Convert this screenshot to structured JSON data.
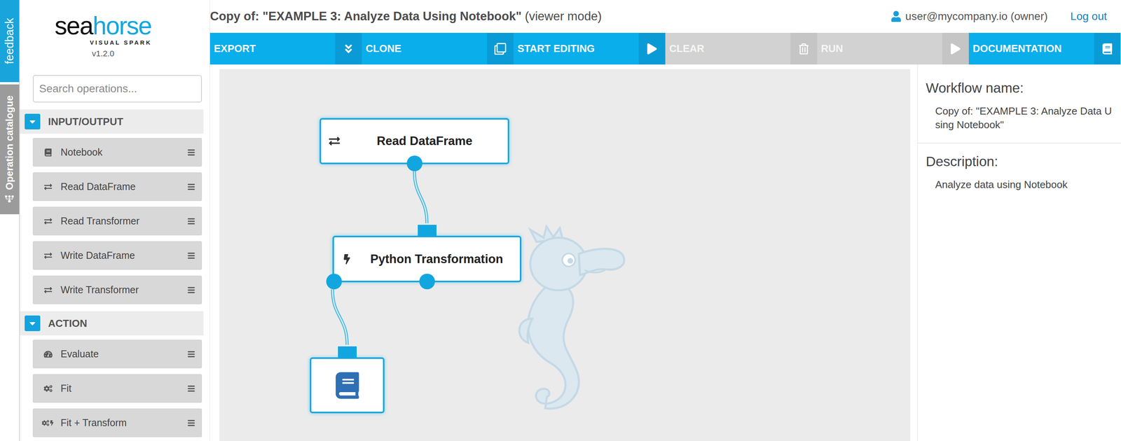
{
  "window": {
    "title": "Copy of: \"EXAMPLE 3: Analyze Data Using Notebook\"",
    "mode": "(viewer mode)"
  },
  "user": {
    "name": "user@mycompany.io (owner)",
    "logout": "Log out"
  },
  "side_tabs": [
    {
      "label": "feedback",
      "kind": "feedback"
    },
    {
      "label": "Operation catalogue",
      "kind": "catalogue"
    }
  ],
  "logo": {
    "brand_dark": "sea",
    "brand_light": "horse",
    "tagline": "VISUAL SPARK",
    "version": "v1.2.0"
  },
  "search": {
    "placeholder": "Search operations..."
  },
  "catalogue": [
    {
      "title": "INPUT/OUTPUT",
      "expanded": true,
      "items": [
        {
          "label": "Notebook",
          "kind": "notebook"
        },
        {
          "label": "Read DataFrame",
          "kind": "io"
        },
        {
          "label": "Read Transformer",
          "kind": "io"
        },
        {
          "label": "Write DataFrame",
          "kind": "io"
        },
        {
          "label": "Write Transformer",
          "kind": "io"
        }
      ]
    },
    {
      "title": "ACTION",
      "expanded": true,
      "items": [
        {
          "label": "Evaluate",
          "kind": "evaluate"
        },
        {
          "label": "Fit",
          "kind": "fit"
        },
        {
          "label": "Fit + Transform",
          "kind": "fit-transform"
        }
      ]
    }
  ],
  "toolbar": [
    {
      "label": "EXPORT",
      "kind": "export",
      "disabled": false
    },
    {
      "label": "CLONE",
      "kind": "clone",
      "disabled": false
    },
    {
      "label": "START EDITING",
      "kind": "play",
      "disabled": false
    },
    {
      "label": "CLEAR",
      "kind": "trash",
      "disabled": true
    },
    {
      "label": "RUN",
      "kind": "play",
      "disabled": true
    },
    {
      "label": "DOCUMENTATION",
      "kind": "book",
      "disabled": false
    }
  ],
  "nodes": [
    {
      "label": "Read DataFrame",
      "kind": "io"
    },
    {
      "label": "Python Transformation",
      "kind": "transform"
    },
    {
      "label": "",
      "kind": "notebook"
    }
  ],
  "links": [
    {
      "from": 0,
      "from_port": 0,
      "to": 1
    },
    {
      "from": 1,
      "from_port": 0,
      "to": 2
    }
  ],
  "panel": {
    "name_label": "Workflow name:",
    "name": "Copy of: \"EXAMPLE 3: Analyze Data Using Notebook\"",
    "description_label": "Description:",
    "description": "Analyze data using Notebook"
  }
}
